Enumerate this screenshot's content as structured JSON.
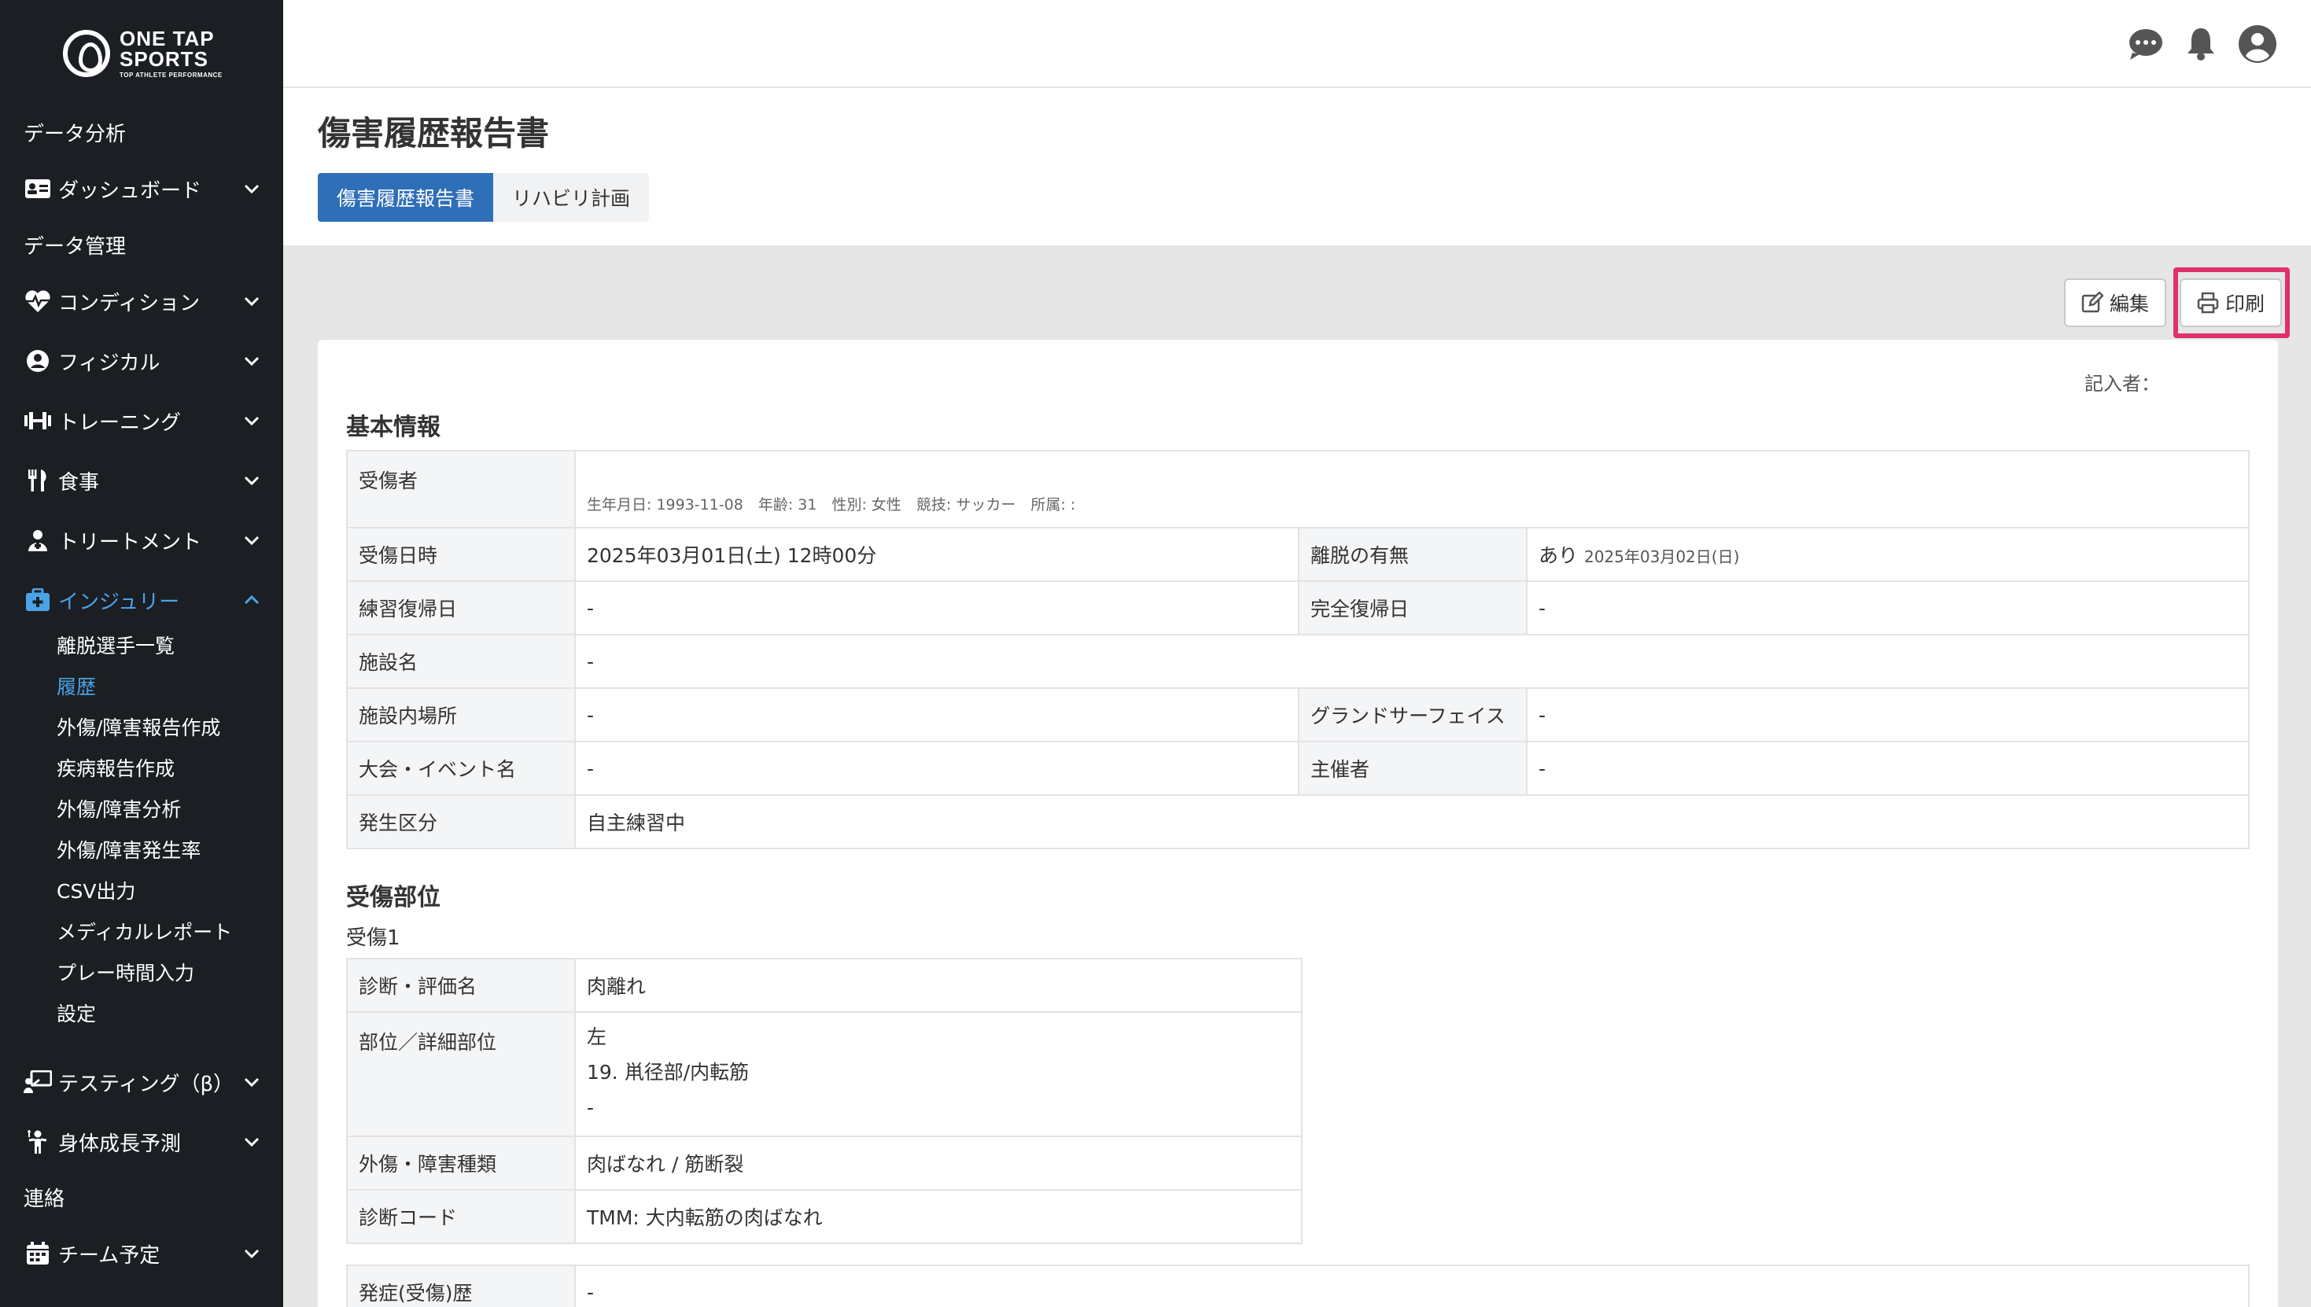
{
  "brand": {
    "line1": "ONE TAP",
    "line2": "SPORTS",
    "tagline": "TOP ATHLETE PERFORMANCE"
  },
  "sidebar": {
    "items": [
      {
        "label": "データ分析"
      },
      {
        "label": "ダッシュボード"
      },
      {
        "label": "データ管理"
      },
      {
        "label": "コンディション"
      },
      {
        "label": "フィジカル"
      },
      {
        "label": "トレーニング"
      },
      {
        "label": "食事"
      },
      {
        "label": "トリートメント"
      },
      {
        "label": "インジュリー"
      },
      {
        "label": "テスティング（β）"
      },
      {
        "label": "身体成長予測"
      },
      {
        "label": "連絡"
      },
      {
        "label": "チーム予定"
      }
    ],
    "injury_sub": [
      {
        "label": "離脱選手一覧"
      },
      {
        "label": "履歴"
      },
      {
        "label": "外傷/障害報告作成"
      },
      {
        "label": "疾病報告作成"
      },
      {
        "label": "外傷/障害分析"
      },
      {
        "label": "外傷/障害発生率"
      },
      {
        "label": "CSV出力"
      },
      {
        "label": "メディカルレポート"
      },
      {
        "label": "プレー時間入力"
      },
      {
        "label": "設定"
      }
    ]
  },
  "page": {
    "title": "傷害履歴報告書",
    "tabs": [
      {
        "label": "傷害履歴報告書"
      },
      {
        "label": "リハビリ計画"
      }
    ],
    "edit_label": "編集",
    "print_label": "印刷",
    "recorder_label": "記入者："
  },
  "basic": {
    "section_title": "基本情報",
    "injured_label": "受傷者",
    "injured_meta": "生年月日: 1993-11-08　年齢: 31　性別: 女性　競技: サッカー　所属: :",
    "rows": {
      "date_label": "受傷日時",
      "date_value": "2025年03月01日(土) 12時00分",
      "absence_label": "離脱の有無",
      "absence_value": "あり",
      "absence_date": "2025年03月02日(日)",
      "practice_return_label": "練習復帰日",
      "practice_return_value": "-",
      "full_return_label": "完全復帰日",
      "full_return_value": "-",
      "facility_label": "施設名",
      "facility_value": "-",
      "facility_place_label": "施設内場所",
      "facility_place_value": "-",
      "surface_label": "グランドサーフェイス",
      "surface_value": "-",
      "event_label": "大会・イベント名",
      "event_value": "-",
      "organizer_label": "主催者",
      "organizer_value": "-",
      "category_label": "発生区分",
      "category_value": "自主練習中"
    }
  },
  "site": {
    "section_title": "受傷部位",
    "injury_label": "受傷1",
    "diagnosis_label": "診断・評価名",
    "diagnosis_value": "肉離れ",
    "part_label": "部位／詳細部位",
    "part_side": "左",
    "part_detail": "19. 鼡径部/内転筋",
    "part_extra": "-",
    "type_label": "外傷・障害種類",
    "type_value": "肉ばなれ / 筋断裂",
    "code_label": "診断コード",
    "code_value": "TMM: 大内転筋の肉ばなれ",
    "history_label": "発症(受傷)歴",
    "history_value": "-"
  }
}
